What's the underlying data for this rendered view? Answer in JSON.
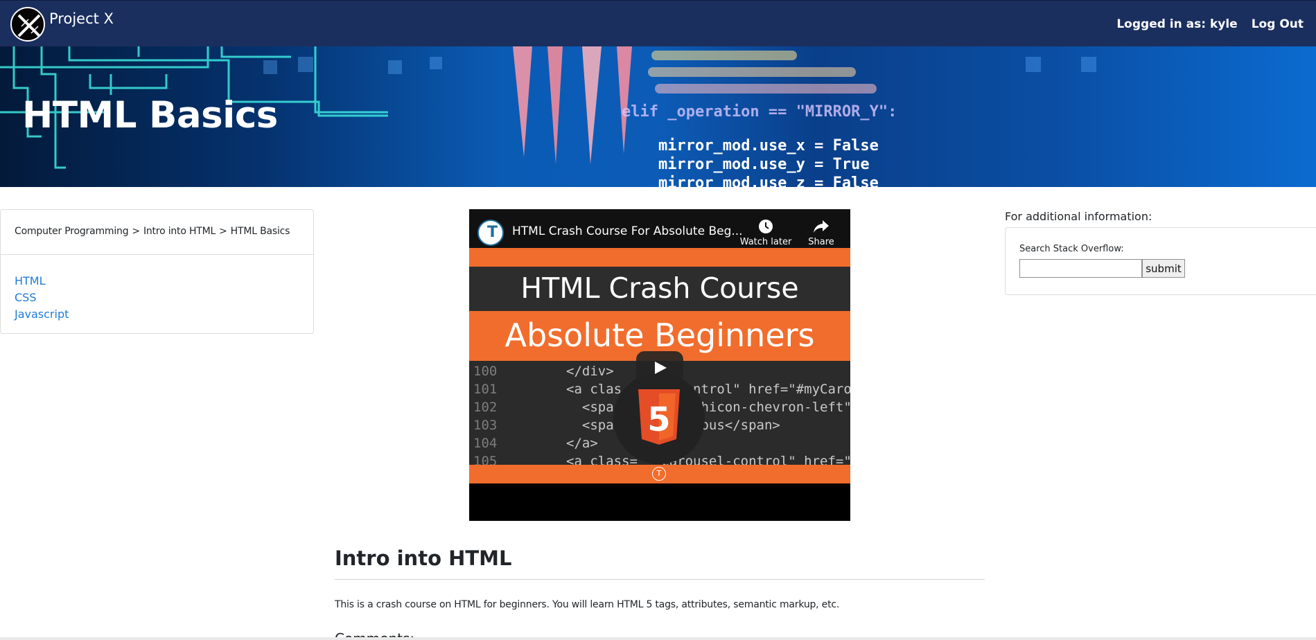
{
  "navbar": {
    "brand": "Project X",
    "logged_in": "Logged in as: kyle",
    "logout": "Log Out"
  },
  "hero": {
    "title": "HTML Basics",
    "code_lines": [
      "elif _operation == \"MIRROR_Y\":",
      "mirror_mod.use_x = False",
      "mirror_mod.use_y = True",
      "mirror_mod.use_z = False"
    ]
  },
  "left_panel": {
    "breadcrumb": [
      "Computer Programming",
      "Intro into HTML",
      "HTML Basics"
    ],
    "breadcrumb_separator": ">",
    "links": [
      "HTML",
      "CSS",
      "Javascript"
    ]
  },
  "video": {
    "channel_letter": "T",
    "title": "HTML Crash Course For Absolute Beg...",
    "watch_later": "Watch later",
    "share": "Share",
    "banner_line1": "HTML Crash Course",
    "banner_line2": "Absolute Beginners",
    "code_numbers": "100\n101\n102\n103\n104\n105",
    "code_text": "</div>\n<a clas   sel-control\" href=\"#myCarousel\"\n  <spa   con glyphicon-chevron-left\"\n  <spa   y\">Previous</span>\n</a>\n<a class=   carousel-control\" href=\"#myCarousel\"",
    "html5_label": "5"
  },
  "main": {
    "section_title": "Intro into HTML",
    "description": "This is a crash course on HTML for beginners. You will learn HTML 5 tags, attributes, semantic markup, etc.",
    "comments_label": "Comments:"
  },
  "sidebar": {
    "info_label": "For additional information:",
    "search_label": "Search Stack Overflow:",
    "search_value": "",
    "submit_label": "submit"
  },
  "colors": {
    "navbar_bg": "#1b2f5e",
    "link": "#1e7bd6",
    "video_orange": "#f16d2d"
  }
}
